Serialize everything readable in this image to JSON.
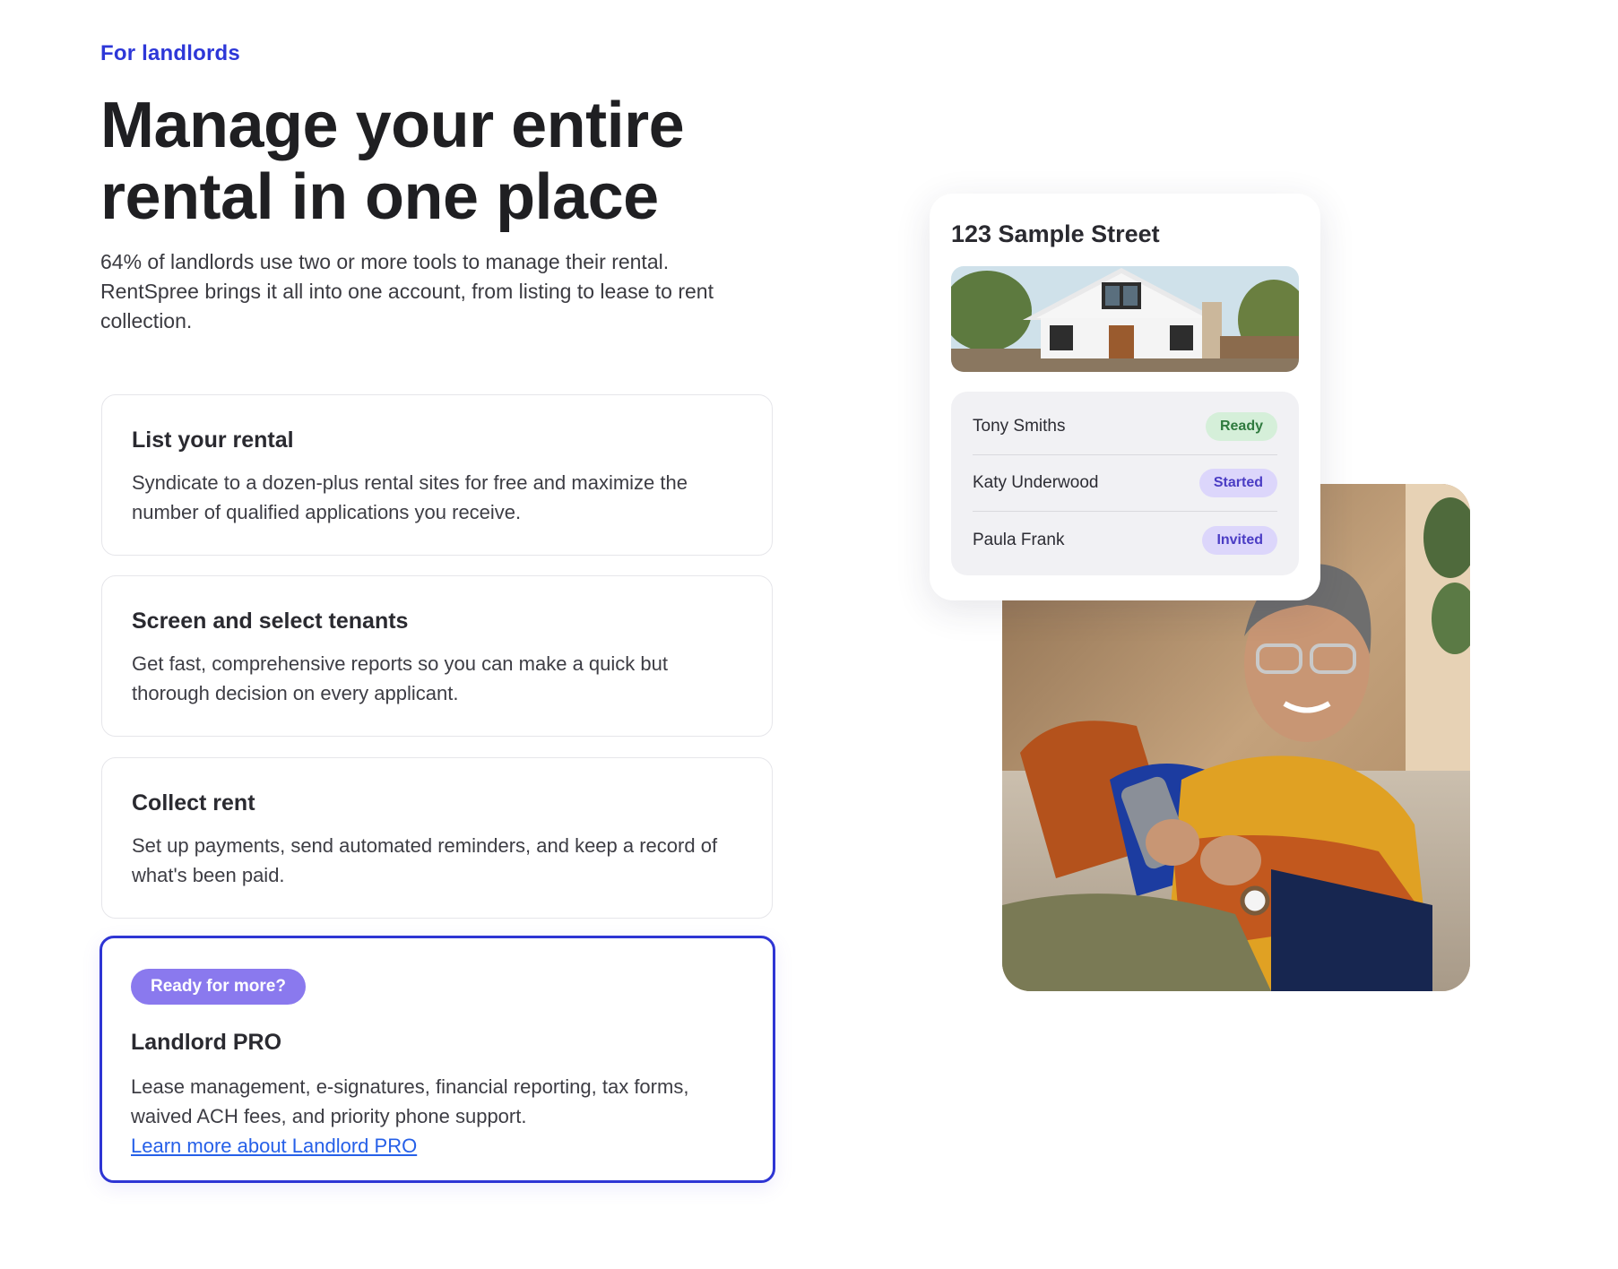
{
  "eyebrow": "For landlords",
  "headline": "Manage your entire rental in one place",
  "intro": "64% of landlords use two or more tools to manage their rental. RentSpree brings it all into one account, from listing to lease to rent collection.",
  "features": [
    {
      "title": "List your rental",
      "body": "Syndicate to a dozen-plus rental sites for free and maximize the number of qualified applications you receive."
    },
    {
      "title": "Screen and select tenants",
      "body": "Get fast, comprehensive reports so you can make a quick but thorough decision on every applicant."
    },
    {
      "title": "Collect rent",
      "body": "Set up payments, send automated reminders, and keep a record of what's been paid."
    }
  ],
  "pro": {
    "badge": "Ready for more?",
    "title": "Landlord PRO",
    "body": "Lease management, e-signatures, financial reporting, tax forms, waived ACH fees, and priority phone support.",
    "link": "Learn more about Landlord PRO"
  },
  "property_card": {
    "address": "123 Sample Street",
    "applicants": [
      {
        "name": "Tony Smiths",
        "status": "Ready"
      },
      {
        "name": "Katy Underwood",
        "status": "Started"
      },
      {
        "name": "Paula Frank",
        "status": "Invited"
      }
    ]
  },
  "colors": {
    "accent_blue": "#2e35d4",
    "eyebrow_blue": "#2d37d8",
    "link_blue": "#2660e8",
    "pro_badge_purple": "#8a79ee",
    "status_ready_bg": "#d5efd9",
    "status_ready_text": "#2f7a3e",
    "status_started_bg": "#dcd6fb",
    "status_started_text": "#4a3cc4",
    "status_invited_bg": "#dcd6fb",
    "status_invited_text": "#4a3cc4"
  }
}
